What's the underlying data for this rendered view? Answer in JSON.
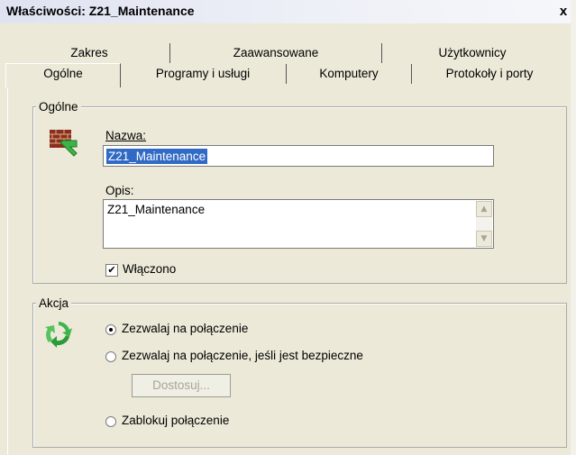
{
  "window": {
    "title": "Właściwości: Z21_Maintenance",
    "close_glyph": "x"
  },
  "tabs_row1": [
    {
      "label": "Zakres"
    },
    {
      "label": "Zaawansowane"
    },
    {
      "label": "Użytkownicy"
    }
  ],
  "tabs_row2": [
    {
      "label": "Ogólne",
      "active": true
    },
    {
      "label": "Programy i usługi"
    },
    {
      "label": "Komputery"
    },
    {
      "label": "Protokoły i porty"
    }
  ],
  "general": {
    "legend": "Ogólne",
    "icon": "firewall-rule-icon",
    "name_label": "Nazwa:",
    "name_value": "Z21_Maintenance",
    "description_label": "Opis:",
    "description_value": "Z21_Maintenance",
    "enabled_label": "Włączono",
    "enabled_checked": true
  },
  "action": {
    "legend": "Akcja",
    "icon": "recycle-arrows-icon",
    "options": [
      {
        "label": "Zezwalaj na połączenie",
        "selected": true
      },
      {
        "label": "Zezwalaj na połączenie, jeśli jest bezpieczne",
        "selected": false
      },
      {
        "label": "Zablokuj połączenie",
        "selected": false
      }
    ],
    "customize_button": "Dostosuj..."
  },
  "colors": {
    "selection": "#316ac5",
    "dialog": "#ece9d8",
    "title_gradient_start": "#dfe3f1"
  }
}
